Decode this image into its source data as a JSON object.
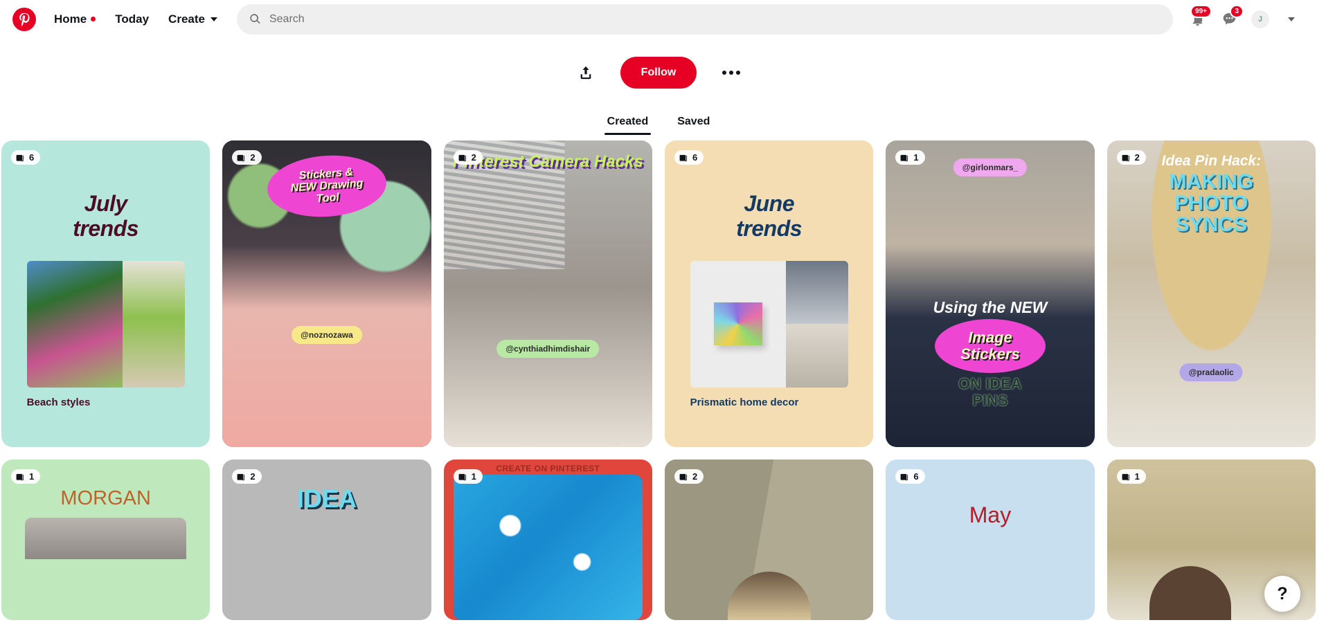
{
  "header": {
    "logo_icon": "pinterest-logo-icon",
    "nav": [
      {
        "label": "Home",
        "has_dot": true
      },
      {
        "label": "Today",
        "has_dot": false
      },
      {
        "label": "Create",
        "has_dot": false,
        "has_chevron": true
      }
    ],
    "search": {
      "placeholder": "Search",
      "value": "",
      "icon": "search-icon"
    },
    "notifications": {
      "icon": "bell-icon",
      "badge": "99+"
    },
    "messages": {
      "icon": "speech-bubble-icon",
      "badge": "3"
    },
    "avatar": {
      "icon": "avatar",
      "initial": "J"
    },
    "account_chevron": "chevron-down-icon"
  },
  "profile_actions": {
    "share_icon": "share-upload-icon",
    "follow_label": "Follow",
    "more_icon": "more-horizontal-icon"
  },
  "tabs": [
    {
      "label": "Created",
      "active": true
    },
    {
      "label": "Saved",
      "active": false
    }
  ],
  "boards": [
    {
      "layout": "trend",
      "count": "6",
      "bg": "#b6e7dd",
      "title": "July trends",
      "title_color": "#4a0d23",
      "label": "Beach styles",
      "label_color": "#4a0d23",
      "thumb_colors": [
        "#3f7a3a",
        "#c4668f",
        "#d8cfc0",
        "#9db87d"
      ]
    },
    {
      "layout": "photo",
      "count": "2",
      "bg": "#2b2b30",
      "oval_text": "Stickers &\nNEW Drawing\nTool",
      "oval_color": "#ee46d3",
      "oval_text_color": "#fdf6c3",
      "handle": "@noznozawa",
      "handle_bg": "#f7e98a"
    },
    {
      "layout": "photo",
      "count": "2",
      "bg": "#b9b8b4",
      "title": "Pinterest Camera Hacks",
      "title_color": "#c8f25e",
      "title_shadow": "#5b2d8e",
      "handle": "@cynthiadhimdishair",
      "handle_bg": "#b7e8a4"
    },
    {
      "layout": "trend",
      "count": "6",
      "bg": "#f5ddb3",
      "title": "June trends",
      "title_color": "#123a63",
      "label": "Prismatic home decor",
      "label_color": "#123a63",
      "thumb_colors": [
        "#ececec",
        "#8e96a3",
        "#cfcfcf",
        "#e8e4df"
      ]
    },
    {
      "layout": "photo",
      "count": "1",
      "bg": "#9b9a96",
      "handle": "@girlonmars_",
      "handle_bg": "#efa8ee",
      "line1": "Using the NEW",
      "line1_color": "#ffffff",
      "oval_text": "Image\nStickers",
      "oval_color": "#ee46d3",
      "oval_text_color": "#fdf6c3",
      "line3": "ON IDEA\nPINS",
      "line3_color": "#1f3a2a"
    },
    {
      "layout": "photo",
      "count": "2",
      "bg": "#cfc6b5",
      "kicker": "Idea Pin Hack:",
      "kicker_color": "#ffffff",
      "title": "MAKING\nPHOTO\nSYNCS",
      "title_color": "#6ddaf0",
      "handle": "@pradaolic",
      "handle_bg": "#b3a7e8"
    }
  ],
  "boards_row2": [
    {
      "count": "1",
      "bg": "#bfe8bd",
      "text": "MORGAN",
      "text_color": "#c0622a"
    },
    {
      "count": "2",
      "bg": "#b9b9b9",
      "text": "IDEA",
      "text_color": "#6ddaf0"
    },
    {
      "count": "1",
      "bg": "#e0463c",
      "text": "CREATE ON PINTEREST",
      "text_color": "#9c2b24"
    },
    {
      "count": "2",
      "bg": "#a7a18b",
      "text": "",
      "text_color": "#ffffff"
    },
    {
      "count": "6",
      "bg": "#c8dff0",
      "text": "May",
      "text_color": "#b41c28"
    },
    {
      "count": "1",
      "bg": "#cbbf9a",
      "text": "",
      "text_color": "#ffffff"
    }
  ],
  "help_button": {
    "label": "?"
  }
}
